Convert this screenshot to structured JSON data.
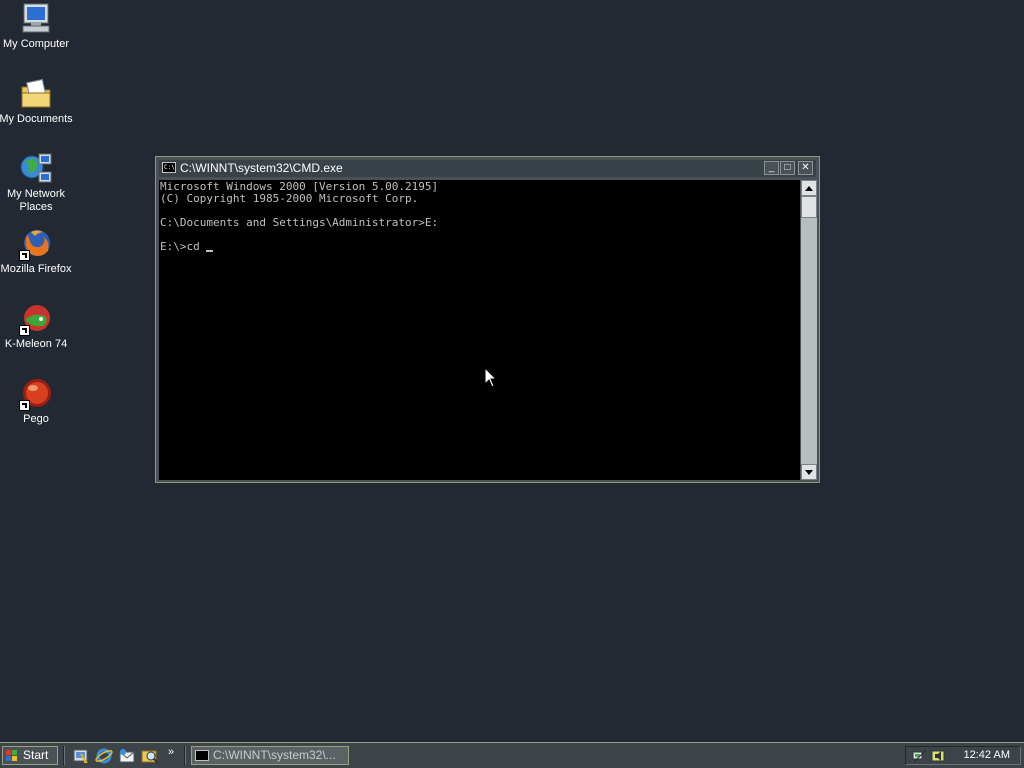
{
  "desktop": {
    "icons": [
      {
        "label": "My Computer",
        "icon": "my-computer-icon"
      },
      {
        "label": "My Documents",
        "icon": "my-documents-icon"
      },
      {
        "label": "My Network Places",
        "icon": "network-places-icon"
      },
      {
        "label": "Mozilla Firefox",
        "icon": "firefox-icon"
      },
      {
        "label": "K-Meleon 74",
        "icon": "k-meleon-icon"
      },
      {
        "label": "Pego",
        "icon": "pego-icon"
      }
    ]
  },
  "cmd_window": {
    "title": "C:\\WINNT\\system32\\CMD.exe",
    "icon_text": "C:\\",
    "minimize": "_",
    "maximize": "□",
    "close": "✕",
    "lines": [
      "Microsoft Windows 2000 [Version 5.00.2195]",
      "(C) Copyright 1985-2000 Microsoft Corp.",
      "",
      "C:\\Documents and Settings\\Administrator>E:",
      "",
      "E:\\>cd "
    ]
  },
  "taskbar": {
    "start_label": "Start",
    "quick_launch_more": "»",
    "task_label": "C:\\WINNT\\system32\\...",
    "clock": "12:42 AM"
  },
  "colors": {
    "desktop_bg": "#232932",
    "console_bg": "#000000",
    "console_fg": "#c0c0c0",
    "taskbar_bg": "#3c4349"
  }
}
